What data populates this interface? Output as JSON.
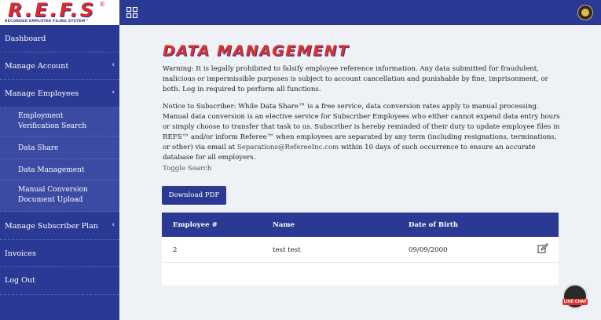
{
  "brand": {
    "logo_text": "R.E.F.S",
    "logo_reg": "®",
    "logo_sub": "RECORDED EMPLOYEE FILING SYSTEM™"
  },
  "sidebar": {
    "items": [
      {
        "label": "Dashboard"
      },
      {
        "label": "Manage Account",
        "chevron": "‹"
      },
      {
        "label": "Manage Employees",
        "chevron": "‹"
      },
      {
        "label": "Manage Subscriber Plan",
        "chevron": "‹"
      },
      {
        "label": "Invoices"
      },
      {
        "label": "Log Out"
      }
    ],
    "sub_items": [
      {
        "label": "Employment Verification Search"
      },
      {
        "label": "Data Share"
      },
      {
        "label": "Data Management"
      },
      {
        "label": "Manual Conversion Document Upload"
      }
    ]
  },
  "main": {
    "title": "DATA MANAGEMENT",
    "warning": "Warning: It is legally prohibited to falsify employee reference information. Any data submitted for fraudulent, malicious or impermissible purposes is subject to account cancellation and punishable by fine, imprisonment, or both. Log in required to perform all functions.",
    "notice": "Notice to Subscriber: While Data Share™ is a free service, data conversion rates apply to manual processing. Manual data conversion is an elective service for Subscriber Employees who either cannot expend data entry hours or simply choose to transfer that task to us. Subscriber is hereby reminded of their duty to update employee files in REFS™ and/or inform Referee™ when employees are separated by any term (including resignations, terminations, or other) via email at",
    "notice_email": "Separations@RefereeInc.com",
    "notice_tail": " within 10 days of such occurrence to ensure an accurate database for all employers.",
    "toggle_search": "Toggle Search",
    "download_button": "Download PDF",
    "table": {
      "headers": [
        "Employee #",
        "Name",
        "Date of Birth"
      ],
      "rows": [
        [
          "2",
          "test test",
          "09/09/2000"
        ]
      ]
    },
    "live_chat": "LIVE CHAT"
  }
}
